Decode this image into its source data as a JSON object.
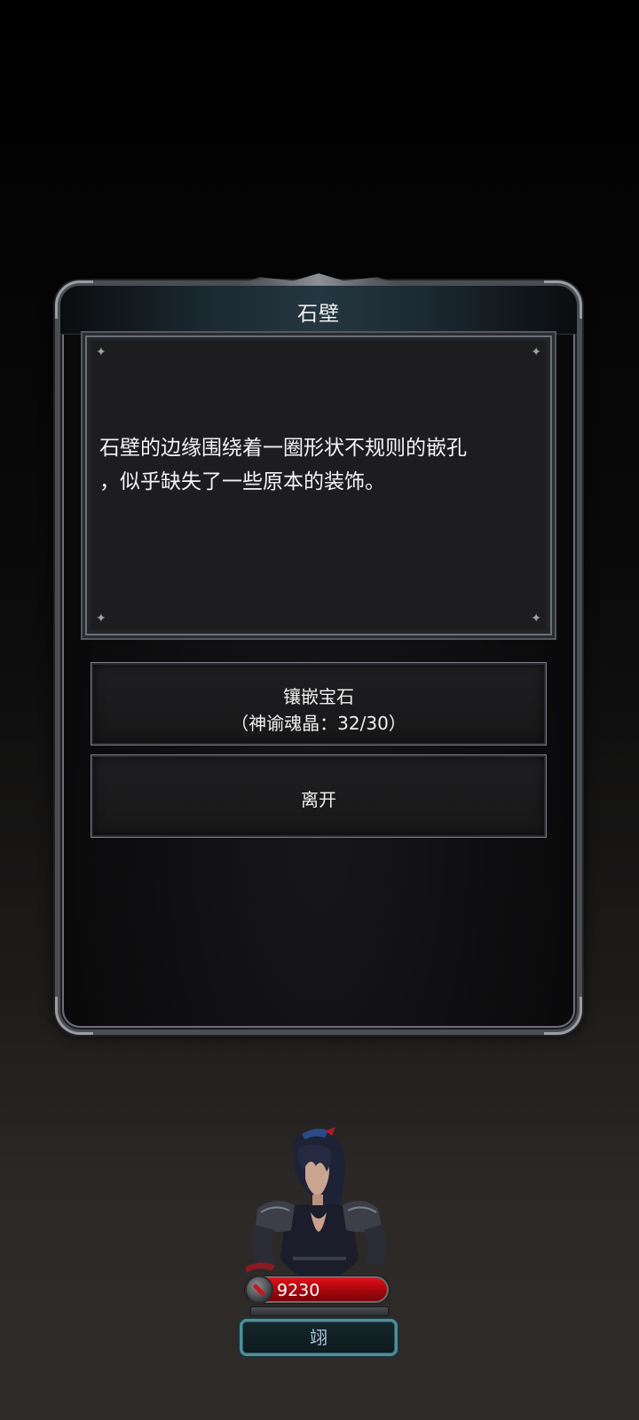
{
  "dialog": {
    "title": "石壁",
    "description": "石壁的边缘围绕着一圈形状不规则的嵌孔\n，似乎缺失了一些原本的装饰。",
    "options": [
      {
        "label": "镶嵌宝石",
        "sublabel": "（神谕魂晶：32/30）"
      },
      {
        "label": "离开"
      }
    ]
  },
  "hero": {
    "hp": "9230",
    "skill_label": "翊"
  },
  "colors": {
    "hp_bar": "#c10a12",
    "skill_border": "#4e8f9a",
    "frame": "#4a4d52"
  },
  "icons": {
    "hp_icon": "sword-icon",
    "sparkle": "sparkle-icon"
  }
}
